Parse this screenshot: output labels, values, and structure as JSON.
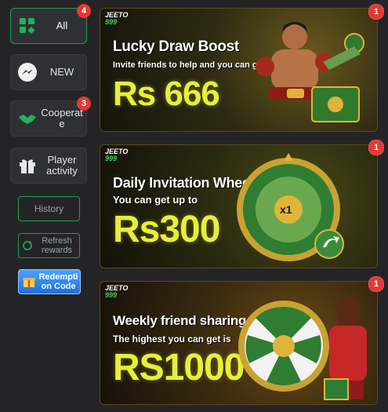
{
  "sidebar": {
    "items": [
      {
        "label": "All",
        "icon": "grid-icon",
        "badge": "4"
      },
      {
        "label": "NEW",
        "icon": "messenger-icon",
        "badge": ""
      },
      {
        "label": "Cooperate",
        "icon": "handshake-icon",
        "badge": "3"
      },
      {
        "label": "Player activity",
        "icon": "gift-icon",
        "badge": ""
      }
    ],
    "history_label": "History",
    "refresh_label": "Refresh rewards",
    "redeem_label": "Redemption Code"
  },
  "banners": [
    {
      "logo_top": "JEETO",
      "logo_bottom": "999",
      "title": "Lucky Draw Boost",
      "subtitle": "Invite friends to help and you can get",
      "amount": "Rs 666",
      "badge": "1"
    },
    {
      "logo_top": "JEETO",
      "logo_bottom": "999",
      "title": "Daily Invitation Wheel",
      "subtitle": "You can get up to",
      "amount": "Rs300",
      "badge": "1",
      "wheel_center": "x1"
    },
    {
      "logo_top": "JEETO",
      "logo_bottom": "999",
      "title": "Weekly friend sharing",
      "subtitle": "The highest you can get is",
      "amount": "RS1000",
      "badge": "1"
    }
  ],
  "colors": {
    "accent_green": "#1f9d55",
    "badge_red": "#e53935",
    "amount_yellow": "#e7ef3a"
  }
}
